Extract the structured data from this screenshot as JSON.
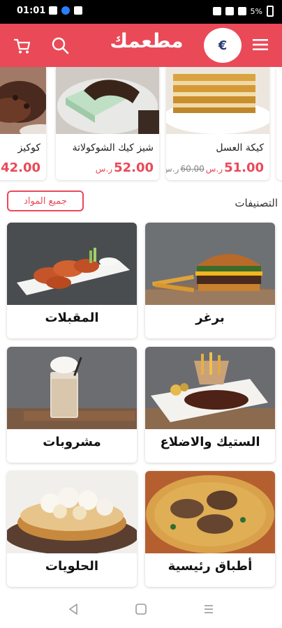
{
  "status_bar": {
    "time": "01:01",
    "battery": "5%"
  },
  "app_bar": {
    "brand": "مطعمك",
    "currency_symbol": "€"
  },
  "featured": [
    {
      "name": "كيكة العسل",
      "price": "51.00",
      "currency": "ر.س",
      "old_price": "60.00",
      "old_currency": "ر.س"
    },
    {
      "name": "شيز كيك الشوكولاتة",
      "price": "52.00",
      "currency": "ر.س"
    },
    {
      "name": "كوكيز",
      "price": "42.00",
      "currency": ""
    }
  ],
  "categories_section": {
    "title": "التصنيفات",
    "all_items_label": "جميع المواد"
  },
  "categories": [
    {
      "label": "برغر"
    },
    {
      "label": "المقبلات"
    },
    {
      "label": "الستيك والاضلاع"
    },
    {
      "label": "مشروبات"
    },
    {
      "label": "أطباق رئيسية"
    },
    {
      "label": "الحلويات"
    }
  ],
  "colors": {
    "brand": "#ea4957",
    "status_bar": "#000000"
  },
  "icons": [
    "cart-icon",
    "search-icon",
    "menu-icon",
    "back-icon",
    "home-icon",
    "recents-icon"
  ]
}
